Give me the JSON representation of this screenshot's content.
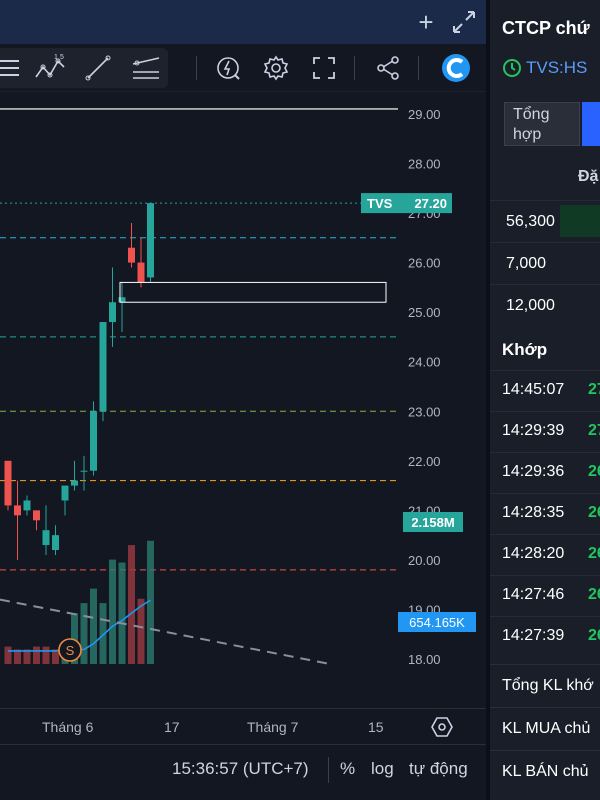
{
  "chart": {
    "symbol_label": "TVS",
    "last_price_label": "27.20",
    "volume_label": "2.158M",
    "avg_volume_label": "654.165K",
    "y_ticks": [
      "29.00",
      "28.00",
      "27.00",
      "26.00",
      "25.00",
      "24.00",
      "23.00",
      "22.00",
      "21.00",
      "20.00",
      "19.00",
      "18.00"
    ],
    "event_marker": "S",
    "colors": {
      "up": "#26a69a",
      "down": "#ef5350",
      "background": "#131722",
      "grid_text": "#b2b5be"
    }
  },
  "chart_data": {
    "type": "candlestick",
    "y_range": [
      17.9,
      29.2
    ],
    "candles": [
      {
        "o": 22.0,
        "h": 22.0,
        "l": 21.0,
        "c": 21.1
      },
      {
        "o": 21.1,
        "h": 21.6,
        "l": 20.0,
        "c": 20.9
      },
      {
        "o": 21.0,
        "h": 21.3,
        "l": 20.9,
        "c": 21.2
      },
      {
        "o": 21.0,
        "h": 21.0,
        "l": 20.6,
        "c": 20.8
      },
      {
        "o": 20.3,
        "h": 21.1,
        "l": 20.1,
        "c": 20.6
      },
      {
        "o": 20.2,
        "h": 20.7,
        "l": 20.1,
        "c": 20.5
      },
      {
        "o": 21.2,
        "h": 21.4,
        "l": 20.9,
        "c": 21.5
      },
      {
        "o": 21.5,
        "h": 22.0,
        "l": 21.4,
        "c": 21.6
      },
      {
        "o": 21.8,
        "h": 22.1,
        "l": 21.4,
        "c": 21.8
      },
      {
        "o": 21.8,
        "h": 23.2,
        "l": 21.7,
        "c": 23.0
      },
      {
        "o": 23.0,
        "h": 24.8,
        "l": 22.8,
        "c": 24.8
      },
      {
        "o": 24.8,
        "h": 25.9,
        "l": 24.3,
        "c": 25.2
      },
      {
        "o": 25.2,
        "h": 25.6,
        "l": 24.6,
        "c": 25.3
      },
      {
        "o": 26.3,
        "h": 26.8,
        "l": 25.9,
        "c": 26.0
      },
      {
        "o": 26.0,
        "h": 26.5,
        "l": 25.5,
        "c": 25.6
      },
      {
        "o": 25.7,
        "h": 27.2,
        "l": 25.6,
        "c": 27.2
      }
    ],
    "volume_rel": [
      0.12,
      0.1,
      0.1,
      0.12,
      0.12,
      0.1,
      0.12,
      0.35,
      0.42,
      0.52,
      0.42,
      0.72,
      0.7,
      0.82,
      0.45,
      0.85
    ],
    "volume_dir": [
      "down",
      "down",
      "down",
      "down",
      "down",
      "down",
      "up",
      "up",
      "up",
      "up",
      "up",
      "up",
      "up",
      "down",
      "down",
      "up"
    ],
    "ma_volume_rel": [
      0.09,
      0.09,
      0.09,
      0.09,
      0.09,
      0.09,
      0.1,
      0.1,
      0.1,
      0.14,
      0.2,
      0.26,
      0.3,
      0.35,
      0.4,
      0.44
    ],
    "ma_label": "654.165K",
    "volume_label": "2.158M",
    "horizontal_levels": [
      {
        "y": 29.1,
        "color": "#e0e0e0",
        "style": "solid"
      },
      {
        "y": 27.2,
        "color": "#26a69a",
        "style": "dotted"
      },
      {
        "y": 26.5,
        "color": "#27b3d6",
        "style": "dashed"
      },
      {
        "y": 24.5,
        "color": "#26a69a",
        "style": "dashed"
      },
      {
        "y": 23.0,
        "color": "#7cb342",
        "style": "dashed"
      },
      {
        "y": 21.6,
        "color": "#f5a623",
        "style": "dashed"
      },
      {
        "y": 19.8,
        "color": "#ef5350",
        "style": "dashed"
      }
    ],
    "box_zone": {
      "y_top": 25.6,
      "y_bottom": 25.2
    },
    "trend_line": {
      "y_start": 19.2,
      "y_end": 17.9
    }
  },
  "time_axis": {
    "labels": [
      "Tháng 6",
      "17",
      "Tháng 7",
      "15"
    ]
  },
  "footer": {
    "clock": "15:36:57 (UTC+7)",
    "percent": "%",
    "log": "log",
    "auto": "tự động"
  },
  "right_panel": {
    "title": "CTCP chứ",
    "ticker": "TVS:HS",
    "tab_summary": "Tổng hợp",
    "order_header": "Đặ",
    "orders": [
      "56,300",
      "7,000",
      "12,000"
    ],
    "match_header": "Khớp",
    "matches": [
      {
        "time": "14:45:07",
        "price": "27"
      },
      {
        "time": "14:29:39",
        "price": "27"
      },
      {
        "time": "14:29:36",
        "price": "26"
      },
      {
        "time": "14:28:35",
        "price": "26"
      },
      {
        "time": "14:28:20",
        "price": "26"
      },
      {
        "time": "14:27:46",
        "price": "26"
      },
      {
        "time": "14:27:39",
        "price": "26"
      }
    ],
    "summary_rows": [
      "Tổng KL khớ",
      "KL MUA chủ",
      "KL BÁN chủ"
    ]
  }
}
